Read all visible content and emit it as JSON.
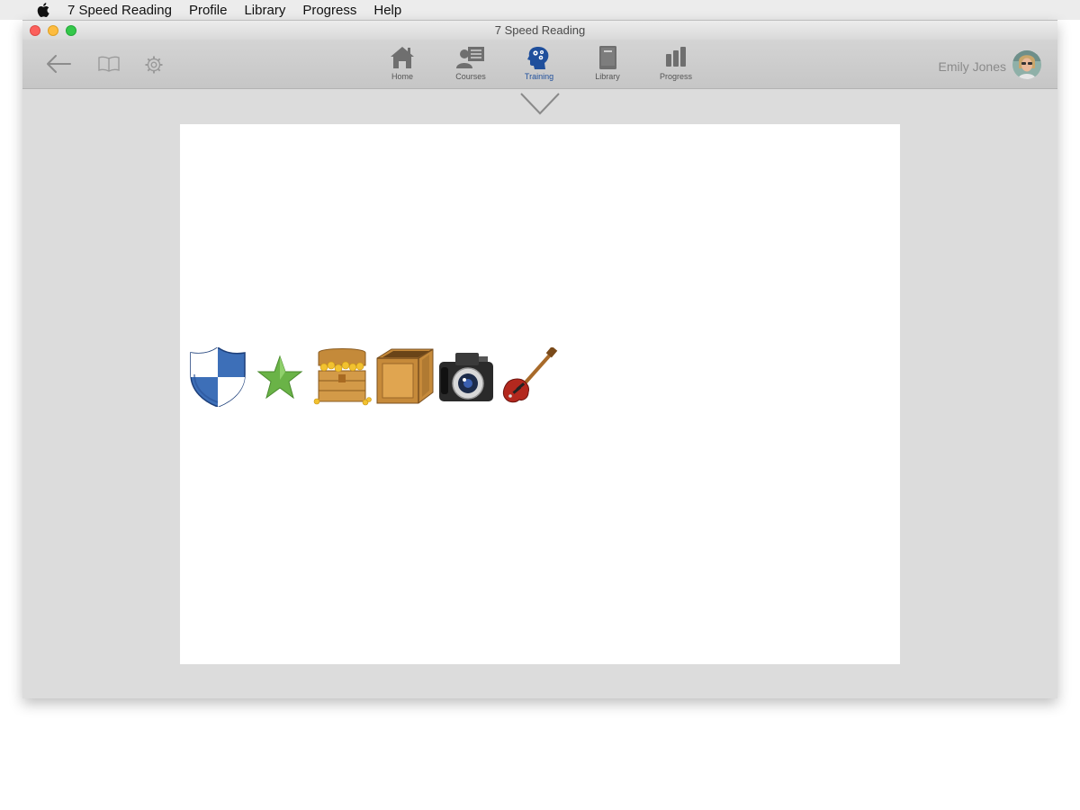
{
  "menubar": {
    "app_name": "7 Speed Reading",
    "items": [
      "Profile",
      "Library",
      "Progress",
      "Help"
    ]
  },
  "window": {
    "title": "7 Speed Reading"
  },
  "toolbar": {
    "nav": [
      {
        "label": "Home",
        "icon": "home-icon"
      },
      {
        "label": "Courses",
        "icon": "courses-icon"
      },
      {
        "label": "Training",
        "icon": "training-brain-icon",
        "active": true
      },
      {
        "label": "Library",
        "icon": "library-book-icon"
      },
      {
        "label": "Progress",
        "icon": "progress-bars-icon"
      }
    ],
    "user_name": "Emily Jones",
    "active_color": "#1f4f9c"
  },
  "exercise": {
    "images": [
      "shield-icon",
      "star-icon",
      "treasure-chest-icon",
      "wooden-crate-icon",
      "camera-icon",
      "electric-guitar-icon"
    ]
  }
}
